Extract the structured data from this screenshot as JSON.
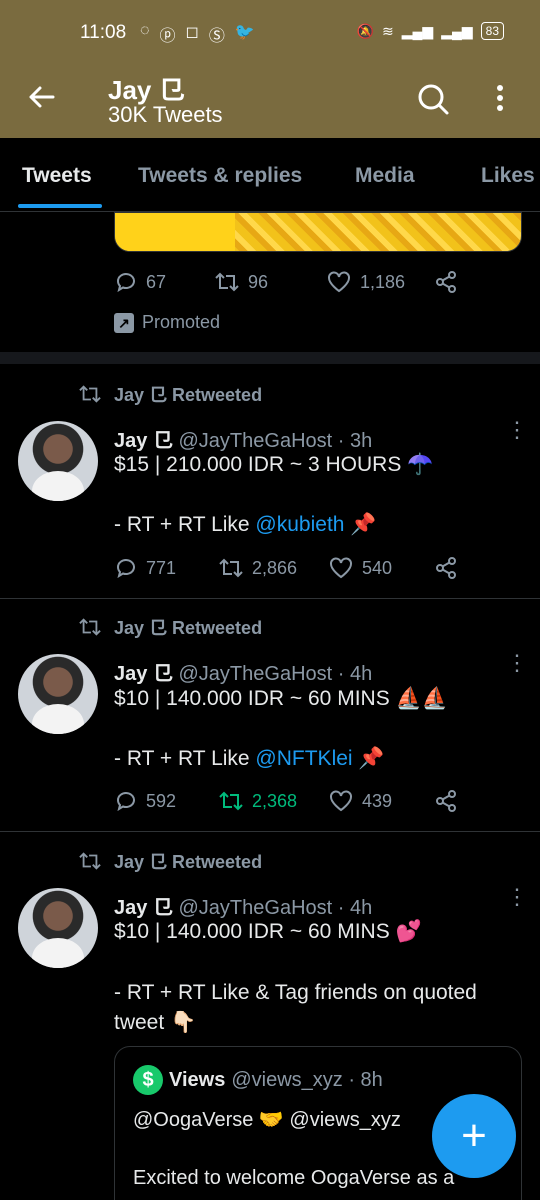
{
  "status_bar": {
    "time": "11:08",
    "battery": "83"
  },
  "header": {
    "name": "Jay ⺋",
    "tweet_count": "30K Tweets"
  },
  "tabs": [
    {
      "label": "Tweets",
      "active": true
    },
    {
      "label": "Tweets & replies",
      "active": false
    },
    {
      "label": "Media",
      "active": false
    },
    {
      "label": "Likes",
      "active": false
    }
  ],
  "promoted_tweet": {
    "replies": "67",
    "retweets": "96",
    "likes": "1,186",
    "promoted_label": "Promoted"
  },
  "tweets": [
    {
      "retweeted_by": "Jay ⺋ Retweeted",
      "name": "Jay ⺋",
      "handle": "@JayTheGaHost · 3h",
      "line1": "$15 | 210.000 IDR ~ 3 HOURS ☂️",
      "line2_prefix": "- RT + RT Like ",
      "line2_link": "@kubieth",
      "line2_suffix": " 📌",
      "replies": "771",
      "retweets": "2,866",
      "likes": "540",
      "retweeted": false
    },
    {
      "retweeted_by": "Jay ⺋ Retweeted",
      "name": "Jay ⺋",
      "handle": "@JayTheGaHost · 4h",
      "line1": "$10 | 140.000 IDR ~ 60 MINS ⛵⛵",
      "line2_prefix": "- RT + RT Like ",
      "line2_link": "@NFTKlei",
      "line2_suffix": " 📌",
      "replies": "592",
      "retweets": "2,368",
      "likes": "439",
      "retweeted": true
    },
    {
      "retweeted_by": "Jay ⺋ Retweeted",
      "name": "Jay ⺋",
      "handle": "@JayTheGaHost · 4h",
      "line1": "$10 | 140.000 IDR ~ 60 MINS 💕",
      "line2": "- RT + RT Like & Tag friends on quoted tweet 👇🏻"
    }
  ],
  "quote": {
    "name": "Views",
    "handle": "@views_xyz · 8h",
    "line1": "@OogaVerse 🤝 @views_xyz",
    "line2": "Excited to welcome OogaVerse as a"
  },
  "fab": {
    "label": "+"
  },
  "colors": {
    "header_bg": "#7a6b3f",
    "accent": "#1d9bf0",
    "retweet_green": "#00ba7c"
  }
}
